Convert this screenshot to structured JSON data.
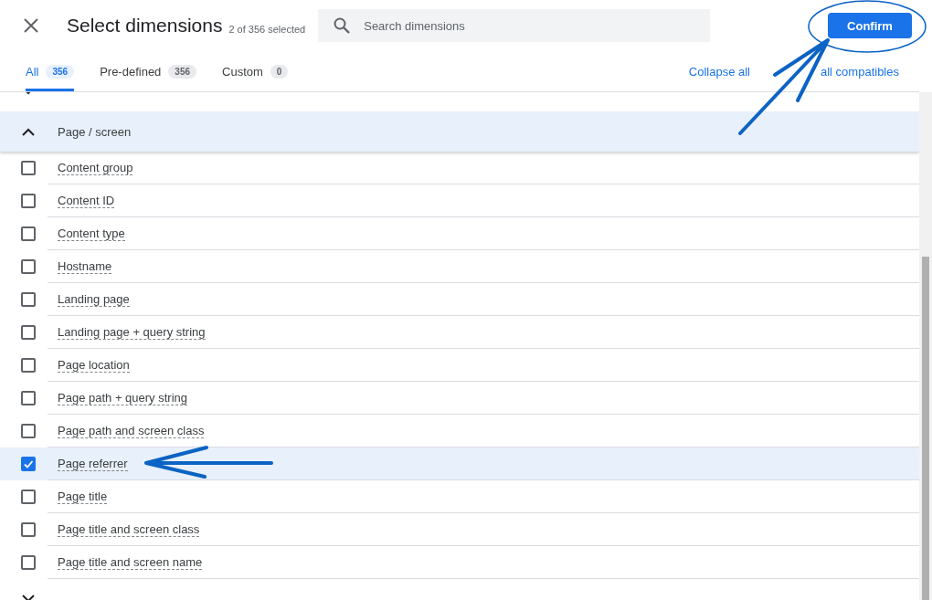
{
  "dialog": {
    "title": "Select dimensions",
    "selection_count": "2 of 356 selected",
    "search": {
      "placeholder": "Search dimensions"
    },
    "confirm_button": "Confirm"
  },
  "tabs": [
    {
      "label": "All",
      "count": "356",
      "selected": true
    },
    {
      "label": "Pre-defined",
      "count": "356",
      "selected": false
    },
    {
      "label": "Custom",
      "count": "0",
      "selected": false
    }
  ],
  "actions": [
    "Collapse all",
    "all compatibles"
  ],
  "groups": [
    {
      "expanded": false
    },
    {
      "label": "Page / screen",
      "expanded": true,
      "items": [
        {
          "label": "Content group",
          "checked": false
        },
        {
          "label": "Content ID",
          "checked": false
        },
        {
          "label": "Content type",
          "checked": false
        },
        {
          "label": "Hostname",
          "checked": false
        },
        {
          "label": "Landing page",
          "checked": false
        },
        {
          "label": "Landing page + query string",
          "checked": false
        },
        {
          "label": "Page location",
          "checked": false
        },
        {
          "label": "Page path + query string",
          "checked": false
        },
        {
          "label": "Page path and screen class",
          "checked": false
        },
        {
          "label": "Page referrer",
          "checked": true
        },
        {
          "label": "Page title",
          "checked": false
        },
        {
          "label": "Page title and screen class",
          "checked": false
        },
        {
          "label": "Page title and screen name",
          "checked": false
        }
      ]
    },
    {
      "expanded": false
    }
  ]
}
